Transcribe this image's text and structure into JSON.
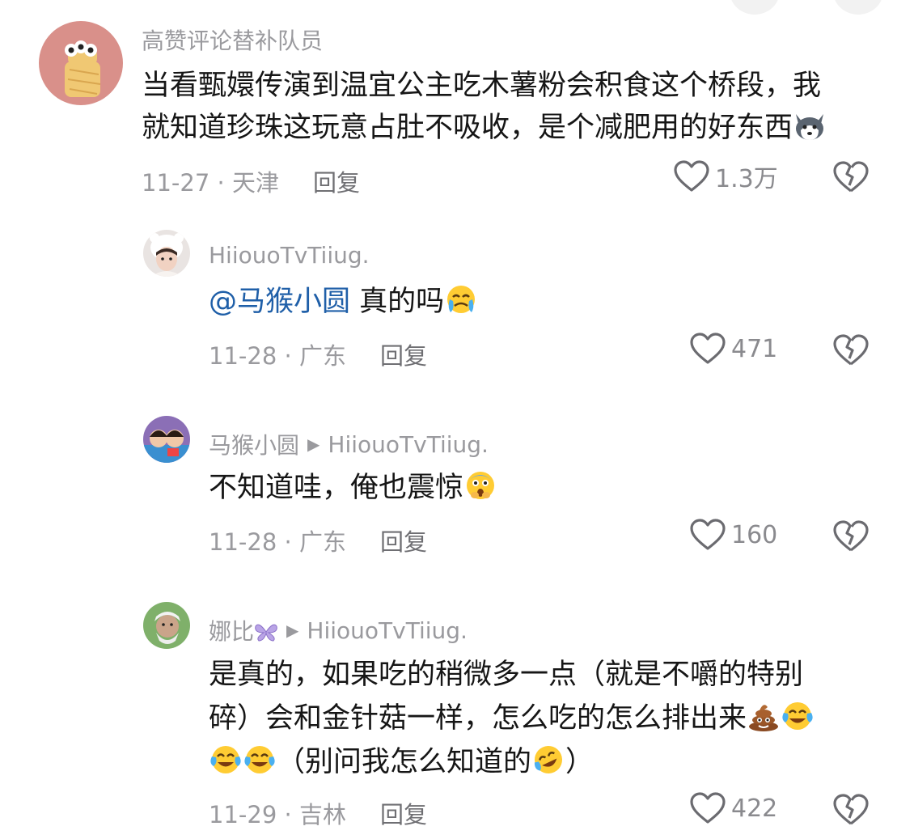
{
  "comments": [
    {
      "username": "高赞评论替补队员",
      "text_line1": "当看甄嬛传演到温宜公主吃木薯粉会积食这个桥段，我",
      "text_line2": "就知道珍珠这玩意占肚不吸收，是个减肥用的好东西",
      "date": "11-27",
      "location": "天津",
      "reply_label": "回复",
      "likes": "1.3万"
    },
    {
      "username": "HiiouoTvTiiug.",
      "mention": "@马猴小圆",
      "text": "真的吗",
      "date": "11-28",
      "location": "广东",
      "reply_label": "回复",
      "likes": "471"
    },
    {
      "username": "马猴小圆",
      "reply_to": "HiiouoTvTiiug.",
      "text": "不知道哇，俺也震惊",
      "date": "11-28",
      "location": "广东",
      "reply_label": "回复",
      "likes": "160"
    },
    {
      "username": "娜比",
      "reply_to": "HiiouoTvTiiug.",
      "text_line1": "是真的，如果吃的稍微多一点（就是不嚼的特别",
      "text_line2": "碎）会和金针菇一样，怎么吃的怎么排出来",
      "text_line3": "（别问我怎么知道的",
      "text_line3_end": "）",
      "date": "11-29",
      "location": "吉林",
      "reply_label": "回复",
      "likes": "422"
    }
  ],
  "separator": " · ",
  "colors": {
    "meta": "#9a9a9e",
    "mention": "#1f5fa8",
    "text": "#161616"
  }
}
